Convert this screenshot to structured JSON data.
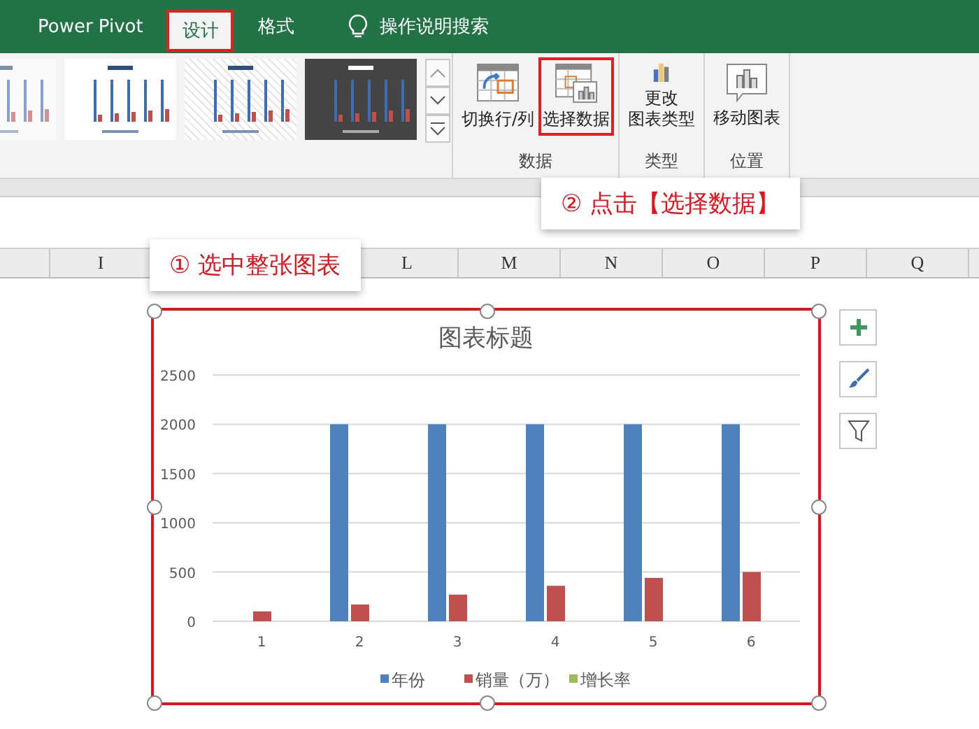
{
  "tabs": [
    {
      "label": "Power Pivot",
      "selected": false,
      "highlighted": false
    },
    {
      "label": "设计",
      "selected": true,
      "highlighted": true
    },
    {
      "label": "格式",
      "selected": false,
      "highlighted": false
    }
  ],
  "tell_me": {
    "placeholder": "操作说明搜索"
  },
  "ribbon": {
    "styles": [
      {
        "kind": "light"
      },
      {
        "kind": "plain"
      },
      {
        "kind": "hatched"
      },
      {
        "kind": "dark"
      }
    ],
    "groups": [
      {
        "label": "数据",
        "buttons": [
          {
            "lines": [
              "切换行/列"
            ],
            "highlighted": false
          },
          {
            "lines": [
              "选择数据"
            ],
            "highlighted": true
          }
        ]
      },
      {
        "label": "类型",
        "buttons": [
          {
            "lines": [
              "更改",
              "图表类型"
            ],
            "highlighted": false
          }
        ]
      },
      {
        "label": "位置",
        "buttons": [
          {
            "lines": [
              "移动图表"
            ],
            "highlighted": false
          }
        ]
      }
    ]
  },
  "callouts": [
    {
      "text": "① 选中整张图表"
    },
    {
      "text": "② 点击【选择数据】"
    }
  ],
  "columns": [
    "I",
    "L",
    "M",
    "N",
    "O",
    "P",
    "Q"
  ],
  "chart": {
    "chart_data": {
      "type": "bar",
      "title": "图表标题",
      "categories": [
        "1",
        "2",
        "3",
        "4",
        "5",
        "6"
      ],
      "series": [
        {
          "name": "年份",
          "color": "#4f81bd",
          "values": [
            null,
            2000,
            2000,
            2000,
            2000,
            2000
          ]
        },
        {
          "name": "销量（万）",
          "color": "#c0504d",
          "values": [
            100,
            170,
            270,
            360,
            440,
            500
          ]
        },
        {
          "name": "增长率",
          "color": "#9bbb59",
          "values": [
            null,
            null,
            null,
            null,
            null,
            null
          ]
        }
      ],
      "grid": true,
      "legend": true,
      "ylim": [
        0,
        2500
      ],
      "yticks": [
        0,
        500,
        1000,
        1500,
        2000,
        2500
      ]
    }
  }
}
